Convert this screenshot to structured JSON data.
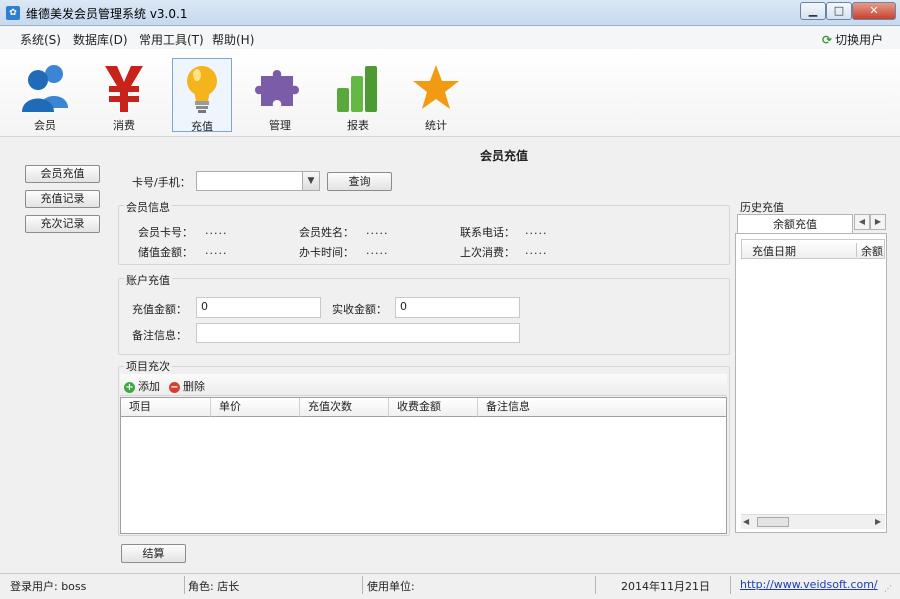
{
  "window": {
    "title": "维德美发会员管理系统 v3.0.1",
    "icon": "app-icon",
    "controls": [
      "minimize",
      "maximize",
      "close"
    ]
  },
  "menu": {
    "items": [
      "系统(S)",
      "数据库(D)",
      "常用工具(T)",
      "帮助(H)"
    ],
    "switch_user": "切换用户"
  },
  "toolbar": {
    "items": [
      {
        "label": "会员",
        "icon": "members-icon"
      },
      {
        "label": "消费",
        "icon": "yen-icon"
      },
      {
        "label": "充值",
        "icon": "lightbulb-icon",
        "active": true
      },
      {
        "label": "管理",
        "icon": "puzzle-icon"
      },
      {
        "label": "报表",
        "icon": "bar-chart-icon"
      },
      {
        "label": "统计",
        "icon": "star-icon"
      }
    ]
  },
  "sidebar": {
    "buttons": [
      "会员充值",
      "充值记录",
      "充次记录"
    ]
  },
  "recharge": {
    "section_title": "会员充值",
    "card_label": "卡号/手机：",
    "card_value": "",
    "query_button": "查询",
    "member_info": {
      "title": "会员信息",
      "fields": [
        {
          "label": "会员卡号：",
          "value": "....."
        },
        {
          "label": "会员姓名：",
          "value": "....."
        },
        {
          "label": "联系电话：",
          "value": "....."
        },
        {
          "label": "储值金额：",
          "value": "....."
        },
        {
          "label": "办卡时间：",
          "value": "....."
        },
        {
          "label": "上次消费：",
          "value": "....."
        }
      ]
    },
    "account": {
      "title": "账户充值",
      "amount_label": "充值金额：",
      "amount_value": "0",
      "received_label": "实收金额：",
      "received_value": "0",
      "note_label": "备注信息：",
      "note_value": ""
    },
    "items": {
      "title": "项目充次",
      "add_label": "添加",
      "delete_label": "删除",
      "columns": [
        "项目",
        "单价",
        "充值次数",
        "收费金额",
        "备注信息"
      ],
      "rows": []
    },
    "settle_button": "结算"
  },
  "history": {
    "title": "历史充值",
    "tab": "余额充值",
    "columns": [
      "充值日期",
      "余额"
    ]
  },
  "statusbar": {
    "login_user": "登录用户: boss",
    "role": "角色: 店长",
    "unit": "使用单位:",
    "date": "2014年11月21日",
    "website": "http://www.veidsoft.com/"
  }
}
